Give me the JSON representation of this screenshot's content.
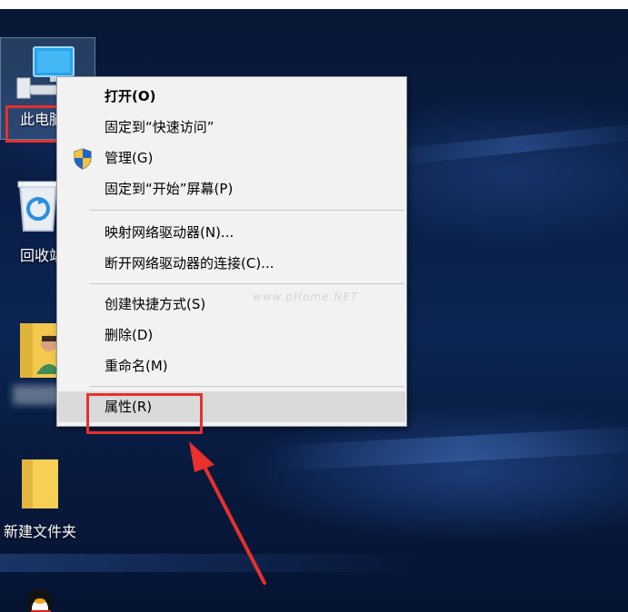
{
  "desktop": {
    "icons": [
      {
        "label": "此电脑"
      },
      {
        "label": "回收站"
      },
      {
        "label": ""
      },
      {
        "label": "新建文件夹"
      },
      {
        "label": ""
      }
    ]
  },
  "context_menu": {
    "items": [
      {
        "label": "打开(O)",
        "bold": true
      },
      {
        "label": "固定到“快速访问”"
      },
      {
        "label": "管理(G)",
        "icon": "shield-icon"
      },
      {
        "label": "固定到“开始”屏幕(P)"
      },
      {
        "label": "映射网络驱动器(N)..."
      },
      {
        "label": "断开网络驱动器的连接(C)..."
      },
      {
        "label": "创建快捷方式(S)"
      },
      {
        "label": "删除(D)"
      },
      {
        "label": "重命名(M)"
      },
      {
        "label": "属性(R)",
        "highlighted": true
      }
    ]
  },
  "watermark": "www.pHome.NET",
  "colors": {
    "annotation_red": "#e8302c",
    "menu_bg": "#f2f2f2",
    "menu_hover": "#dadada",
    "desktop_blue": "#0a1f48"
  }
}
